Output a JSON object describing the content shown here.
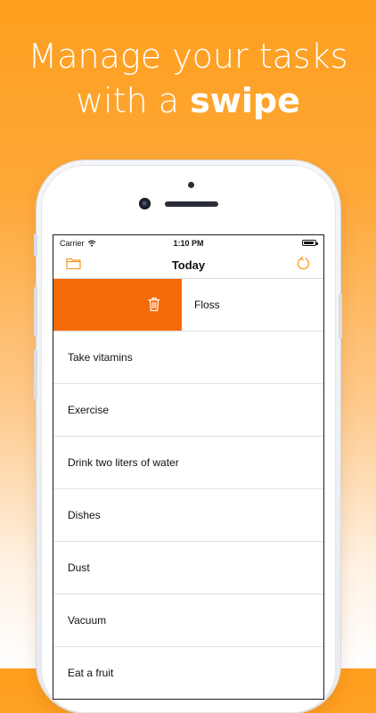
{
  "headline": {
    "line1": "Manage your tasks",
    "line2_prefix": "with a ",
    "line2_bold": "swipe"
  },
  "status_bar": {
    "carrier": "Carrier",
    "time": "1:10 PM",
    "battery_level": 0.95
  },
  "nav": {
    "title": "Today",
    "left_icon": "folder-icon",
    "right_icon": "refresh-icon"
  },
  "tasks": [
    {
      "label": "Floss",
      "swiped": true
    },
    {
      "label": "Take vitamins"
    },
    {
      "label": "Exercise"
    },
    {
      "label": "Drink two liters of water"
    },
    {
      "label": "Dishes"
    },
    {
      "label": "Dust"
    },
    {
      "label": "Vacuum"
    },
    {
      "label": "Eat a fruit"
    }
  ],
  "colors": {
    "accent": "#f46a08",
    "icon": "#f79a23",
    "background_top": "#fe9e1d",
    "background_bottom": "#ffffff"
  }
}
